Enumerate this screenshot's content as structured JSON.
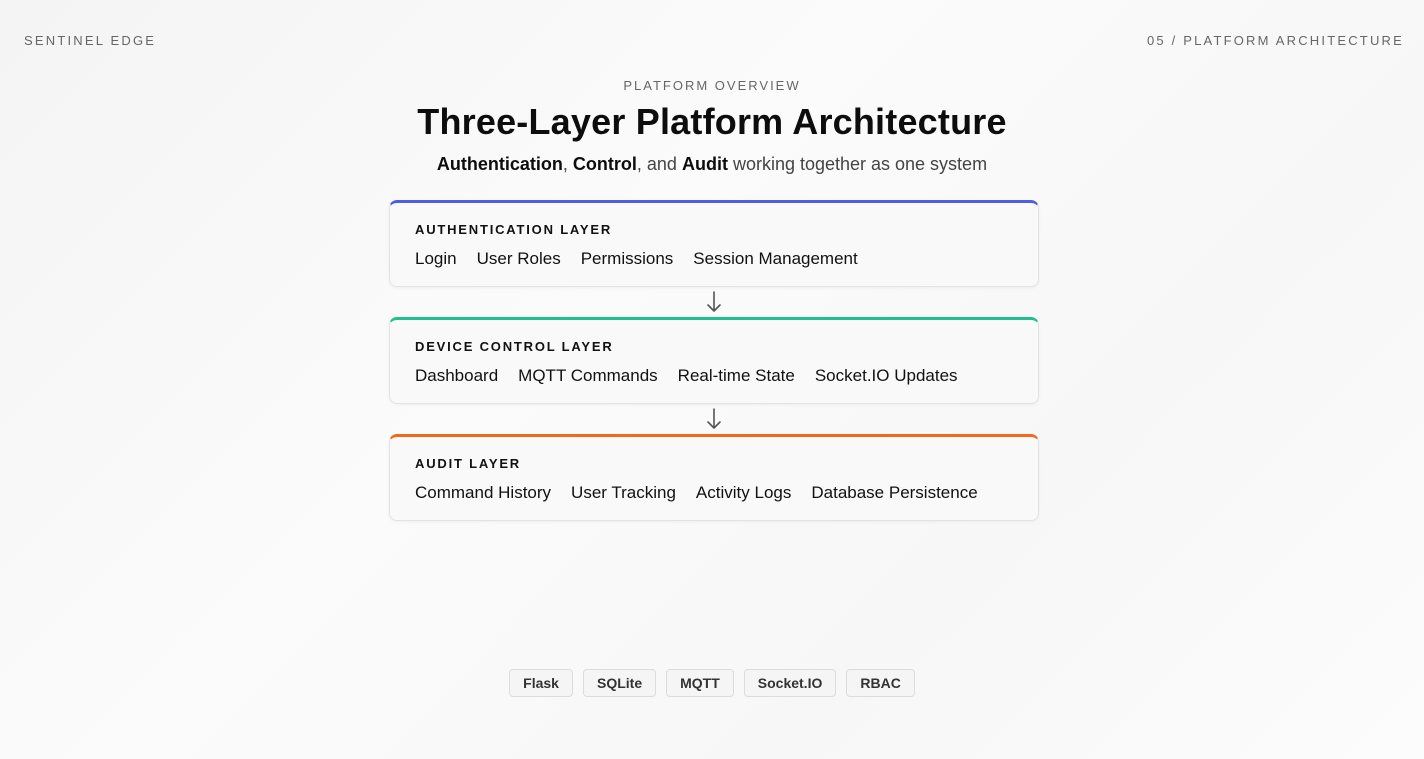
{
  "header": {
    "brand": "SENTINEL EDGE",
    "slide_label": "05 / PLATFORM ARCHITECTURE"
  },
  "intro": {
    "eyebrow": "PLATFORM OVERVIEW",
    "title": "Three-Layer Platform Architecture",
    "subtitle": {
      "term1": "Authentication",
      "sep1": ", ",
      "term2": "Control",
      "sep2": ", and ",
      "term3": "Audit",
      "rest": " working together as one system"
    }
  },
  "layers": [
    {
      "name": "AUTHENTICATION LAYER",
      "accent": "#4f5ee0",
      "items": [
        "Login",
        "User Roles",
        "Permissions",
        "Session Management"
      ]
    },
    {
      "name": "DEVICE CONTROL LAYER",
      "accent": "#1fbf8f",
      "items": [
        "Dashboard",
        "MQTT Commands",
        "Real-time State",
        "Socket.IO Updates"
      ]
    },
    {
      "name": "AUDIT LAYER",
      "accent": "#f06a1c",
      "items": [
        "Command History",
        "User Tracking",
        "Activity Logs",
        "Database Persistence"
      ]
    }
  ],
  "arrow_icon": "arrow-down-icon",
  "tech_tags": [
    "Flask",
    "SQLite",
    "MQTT",
    "Socket.IO",
    "RBAC"
  ]
}
